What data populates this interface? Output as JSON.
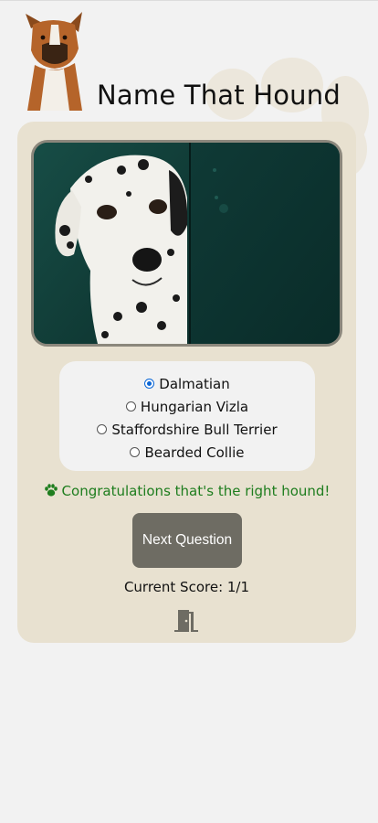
{
  "app": {
    "title": "Name That Hound"
  },
  "quiz": {
    "image_alt": "dalmatian-photo",
    "options": [
      {
        "label": "Dalmatian",
        "selected": true
      },
      {
        "label": "Hungarian Vizla",
        "selected": false
      },
      {
        "label": "Staffordshire Bull Terrier",
        "selected": false
      },
      {
        "label": "Bearded Collie",
        "selected": false
      }
    ],
    "feedback": "Congratulations that's the right hound!",
    "next_label": "Next Question",
    "score": "Current Score: 1/1"
  },
  "colors": {
    "card_background": "#e8e1d0",
    "feedback": "#1e7d1e",
    "button": "#6e6c63",
    "radio_selected": "#0a66d6"
  },
  "icons": {
    "feedback_icon": "paw-icon",
    "exit_icon": "door-exit-icon",
    "logo": "boxer-dog-logo"
  }
}
